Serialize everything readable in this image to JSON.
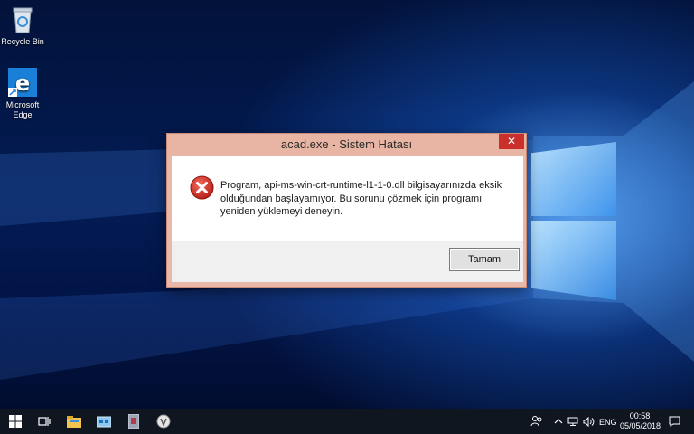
{
  "desktop": {
    "icons": [
      {
        "label": "Recycle Bin",
        "icon": "recycle-bin-icon"
      },
      {
        "label": "Microsoft Edge",
        "icon": "edge-icon"
      }
    ]
  },
  "dialog": {
    "title": "acad.exe - Sistem Hatası",
    "close_label": "✕",
    "icon": "error-icon",
    "message": "Program, api-ms-win-crt-runtime-l1-1-0.dll bilgisayarınızda eksik olduğundan başlayamıyor. Bu sorunu çözmek için programı yeniden yüklemeyi deneyin.",
    "ok_label": "Tamam"
  },
  "taskbar": {
    "items": [
      "start-icon",
      "task-view-icon",
      "file-explorer-icon",
      "store-icon",
      "app-icon",
      "app-icon"
    ],
    "language": "ENG",
    "time": "00:58",
    "date": "05/05/2018"
  },
  "colors": {
    "dialog_frame": "#e8b4a3",
    "close_red": "#c9302c",
    "taskbar": "#0f1620"
  }
}
